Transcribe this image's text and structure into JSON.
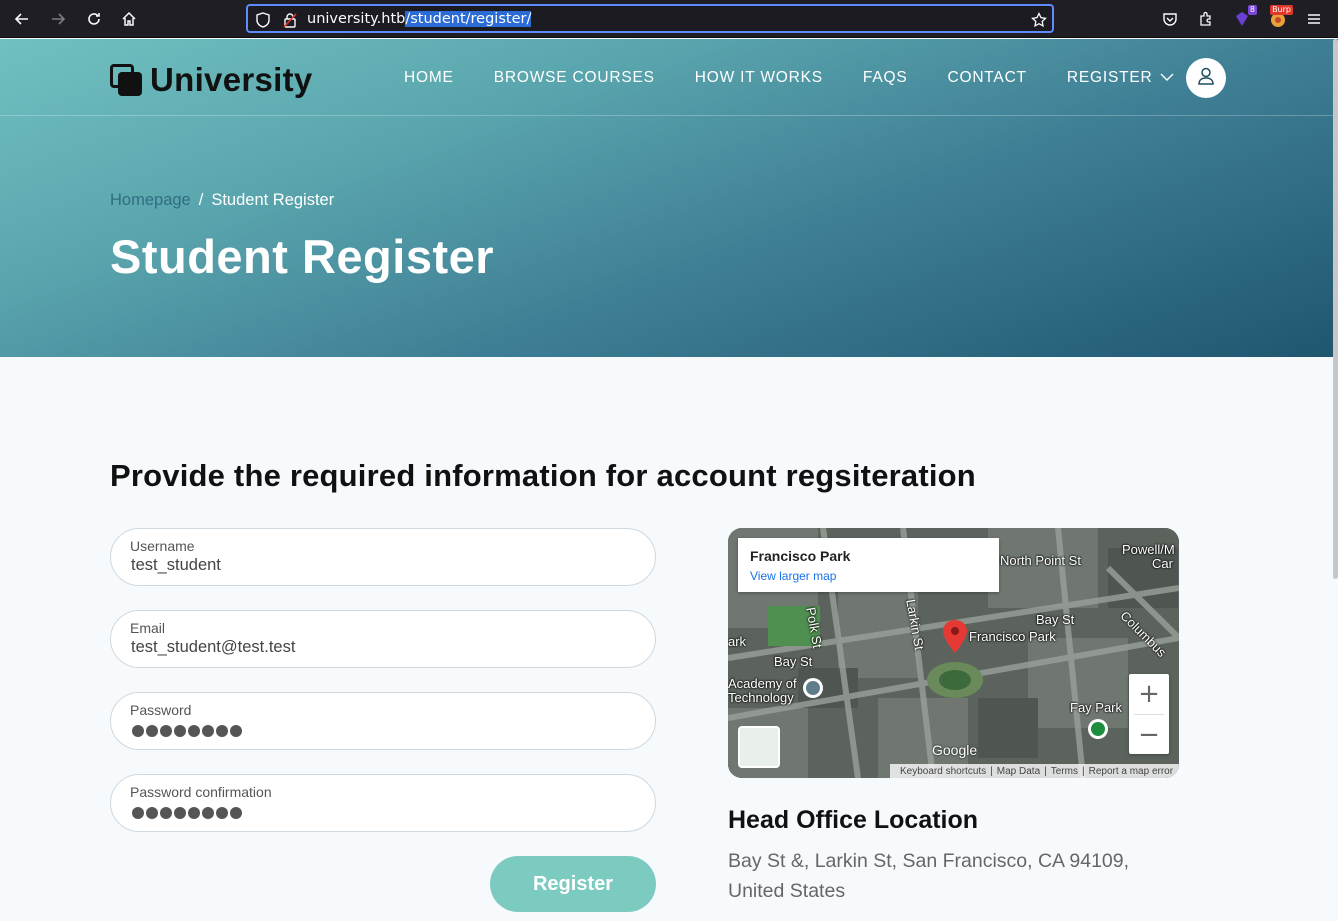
{
  "browser": {
    "url_host": "university.htb",
    "url_path": "/student/register/",
    "extension_badge": "8",
    "burp_badge": "Burp"
  },
  "site": {
    "logo_text": "University",
    "nav": [
      {
        "label": "HOME"
      },
      {
        "label": "BROWSE COURSES"
      },
      {
        "label": "HOW IT WORKS"
      },
      {
        "label": "FAQS"
      },
      {
        "label": "CONTACT"
      },
      {
        "label": "REGISTER"
      }
    ]
  },
  "hero": {
    "breadcrumb_home": "Homepage",
    "breadcrumb_sep": "/",
    "breadcrumb_current": "Student Register",
    "title": "Student Register"
  },
  "form": {
    "heading": "Provide the required information for account regsiteration",
    "username_label": "Username",
    "username_value": "test_student",
    "email_label": "Email",
    "email_value": "test_student@test.test",
    "password_label": "Password",
    "password_confirm_label": "Password confirmation",
    "submit_label": "Register"
  },
  "map": {
    "place_name": "Francisco Park",
    "view_larger": "View larger map",
    "zoom_in": "+",
    "zoom_out": "−",
    "labels": {
      "north_point": "North Point St",
      "powell": "Powell/M",
      "car": "Car",
      "bay_st_left": "Bay St",
      "bay_st_right": "Bay St",
      "polk": "Polk St",
      "larkin": "Larkin St",
      "francisco_park": "Francisco Park",
      "columbus": "Columbus",
      "academy": "Academy of",
      "technology": "Technology",
      "fay_park": "Fay Park",
      "ark": "ark"
    },
    "google": "Google",
    "footer": {
      "shortcuts": "Keyboard shortcuts",
      "map_data": "Map Data",
      "terms": "Terms",
      "report": "Report a map error"
    }
  },
  "office": {
    "title": "Head Office Location",
    "address": "Bay St &, Larkin St, San Francisco, CA 94109, United States"
  }
}
